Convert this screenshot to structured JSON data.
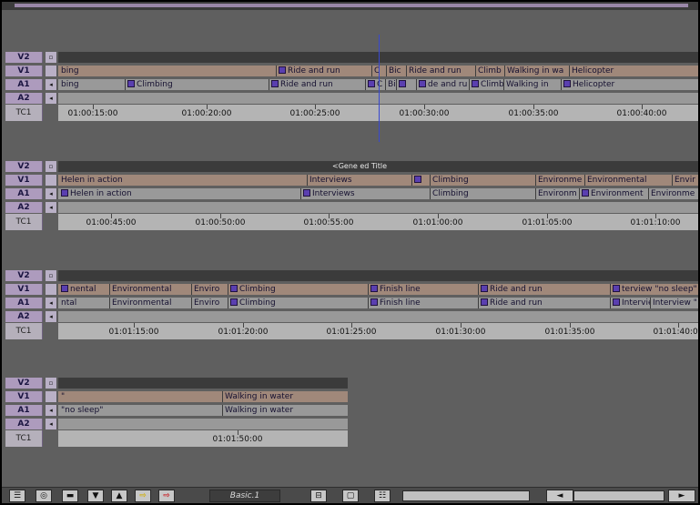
{
  "toolbar": {
    "bin_label": "Basic.1",
    "icons": [
      "timeline-icon",
      "audio-icon",
      "monitor-icon",
      "down-arrow-icon",
      "up-arrow-icon",
      "yellow-lift-icon",
      "red-extract-icon",
      "segment-icon",
      "source-icon",
      "settings-icon",
      "scroll-left-icon",
      "scroll-right-icon"
    ]
  },
  "track_labels": {
    "v2": "V2",
    "v1": "V1",
    "a1": "A1",
    "a2": "A2",
    "tc": "TC1"
  },
  "sections": [
    {
      "v2": [],
      "v1": [
        "bing",
        "Ride and run",
        "C",
        "Bic",
        "Ride and run",
        "Climb",
        "Walking in wa",
        "Helicopter"
      ],
      "a1": [
        "bing",
        "Climbing",
        "Ride and run",
        "C",
        "Bi",
        "",
        "de and ru",
        "Climb",
        "Walking in",
        "Helicopter"
      ],
      "timecodes": [
        "01:00:15:00",
        "01:00:20:00",
        "01:00:25:00",
        "01:00:30:00",
        "01:00:35:00",
        "01:00:40:00"
      ]
    },
    {
      "v2_text": "<Gene  ed Title",
      "v1": [
        "Helen in action",
        "Interviews",
        "Climbing",
        "Environme",
        "Environmental",
        "Envir"
      ],
      "a1": [
        "Helen in action",
        "Interviews",
        "Climbing",
        "Environm",
        "Environment",
        "Environme"
      ],
      "timecodes": [
        "01:00:45:00",
        "01:00:50:00",
        "01:00:55:00",
        "01:01:00:00",
        "01:01:05:00",
        "01:01:10:00"
      ]
    },
    {
      "v1": [
        "nental",
        "Environmental",
        "Enviro",
        "Climbing",
        "Finish line",
        "Ride and run",
        "terview \"no sleep\""
      ],
      "a1": [
        "ntal",
        "Environmental",
        "Enviro",
        "Climbing",
        "Finish line",
        "Ride and run",
        "Intervie",
        "Interview \""
      ],
      "timecodes": [
        "01:01:15:00",
        "01:01:20:00",
        "01:01:25:00",
        "01:01:30:00",
        "01:01:35:00",
        "01:01:40:00"
      ]
    },
    {
      "v1": [
        "\"",
        "Walking in water"
      ],
      "a1": [
        "\"no sleep\"",
        "Walking in water"
      ],
      "timecodes": [
        "01:01:50:00"
      ]
    }
  ]
}
